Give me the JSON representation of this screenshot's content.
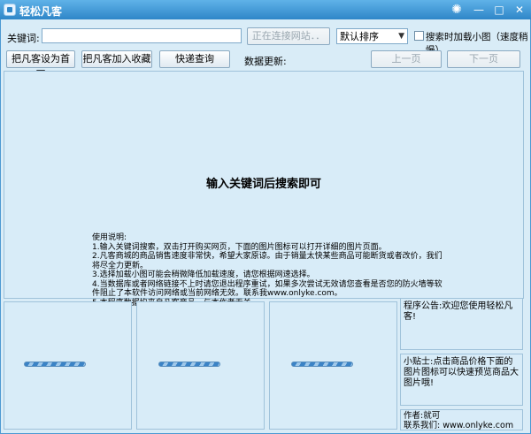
{
  "window": {
    "title": "轻松凡客"
  },
  "toolbar": {
    "keyword_label": "关键词:",
    "keyword_value": "",
    "connecting_button": "正在连接网站．．",
    "sort_selected": "默认排序",
    "thumbnail_checkbox_label": "搜索时加载小图（速度稍慢）",
    "set_homepage_button": "把凡客设为首页",
    "add_favorite_button": "把凡客加入收藏",
    "quick_query_button": "快递查询",
    "data_update_label": "数据更新:",
    "prev_page_button": "上一页",
    "next_page_button": "下一页"
  },
  "main": {
    "prompt": "输入关键词后搜索即可",
    "usage_title": "使用说明:",
    "usage_lines": [
      "1.输入关键词搜索，双击打开购买网页，下面的图片图标可以打开详细的图片页面。",
      "2.凡客商城的商品销售速度非常快，希望大家原谅。由于销量太快某些商品可能断货或者改价，我们",
      "将尽全力更新。",
      "3.选择加载小图可能会稍微降低加载速度，请您根据网速选择。",
      "4.当数据库或者网络链接不上时请您退出程序重试，如果多次尝试无效请您查看是否您的防火墙等软",
      "件阻止了本软件访问网络或当前网络无效。联系我www.onlyke.com。",
      "5.本程序数据均来自凡客商品，与本作者无关。"
    ]
  },
  "side": {
    "announcement": "程序公告:欢迎您使用轻松凡客!",
    "tip": "小贴士:点击商品价格下面的图片图标可以快速预览商品大图片哦!",
    "author": "作者:就可",
    "contact": "联系我们: www.onlyke.com"
  }
}
